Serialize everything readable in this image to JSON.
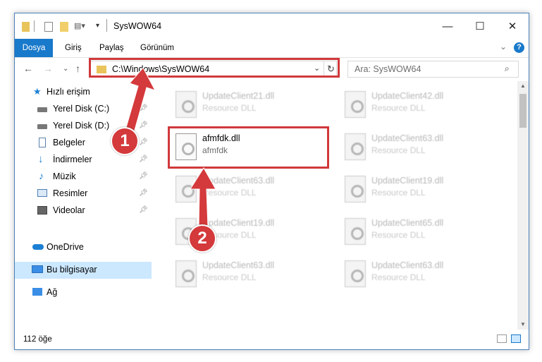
{
  "window": {
    "title": "SysWOW64"
  },
  "window_controls": {
    "minimize": "—",
    "maximize": "☐",
    "close": "✕"
  },
  "ribbon": {
    "tabs": [
      "Dosya",
      "Giriş",
      "Paylaş",
      "Görünüm"
    ]
  },
  "address": {
    "path": "C:\\Windows\\SysWOW64"
  },
  "search": {
    "placeholder": "Ara: SysWOW64"
  },
  "sidebar": {
    "items": [
      {
        "label": "Hızlı erişim",
        "icon": "star-icon"
      },
      {
        "label": "Yerel Disk (C:)",
        "icon": "drive-icon",
        "pinned": true
      },
      {
        "label": "Yerel Disk (D:)",
        "icon": "drive-icon",
        "pinned": true
      },
      {
        "label": "Belgeler",
        "icon": "documents-icon",
        "pinned": true
      },
      {
        "label": "İndirmeler",
        "icon": "download-icon",
        "pinned": true
      },
      {
        "label": "Müzik",
        "icon": "music-icon",
        "pinned": true
      },
      {
        "label": "Resimler",
        "icon": "pictures-icon",
        "pinned": true
      },
      {
        "label": "Videolar",
        "icon": "videos-icon",
        "pinned": true
      },
      {
        "label": "OneDrive",
        "icon": "cloud-icon"
      },
      {
        "label": "Bu bilgisayar",
        "icon": "computer-icon",
        "selected": true
      },
      {
        "label": "Ağ",
        "icon": "network-icon"
      }
    ]
  },
  "files": [
    {
      "name": "UpdateClient21.dll",
      "desc": "Resource DLL"
    },
    {
      "name": "UpdateClient42.dll",
      "desc": "Resource DLL"
    },
    {
      "name": "afmfdk.dll",
      "desc": "afmfdk"
    },
    {
      "name": "UpdateClient63.dll",
      "desc": "Resource DLL"
    },
    {
      "name": "UpdateClient63.dll",
      "desc": "Resource DLL"
    },
    {
      "name": "UpdateClient19.dll",
      "desc": "Resource DLL"
    },
    {
      "name": "UpdateClient19.dll",
      "desc": "Resource DLL"
    },
    {
      "name": "UpdateClient65.dll",
      "desc": "Resource DLL"
    },
    {
      "name": "UpdateClient63.dll",
      "desc": "Resource DLL"
    },
    {
      "name": "UpdateClient63.dll",
      "desc": "Resource DLL"
    }
  ],
  "status": {
    "count": "112 öğe"
  },
  "annotations": {
    "step1": "1",
    "step2": "2"
  },
  "colors": {
    "accent": "#1979ca",
    "highlight": "#d4393b",
    "selection": "#cce8ff"
  }
}
